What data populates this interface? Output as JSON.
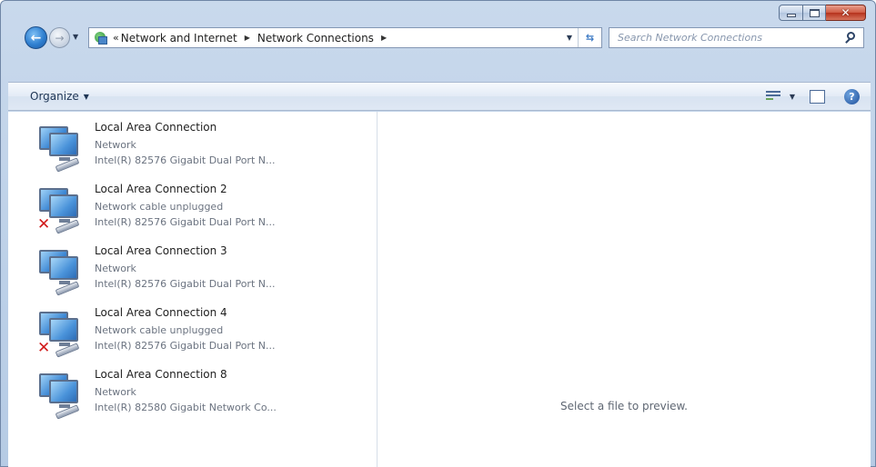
{
  "titlebar": {
    "buttons": {
      "minimize": "minimize",
      "maximize": "maximize",
      "close": "close"
    }
  },
  "address": {
    "overflow": "«",
    "crumbs": [
      "Network and Internet",
      "Network Connections"
    ]
  },
  "search": {
    "placeholder": "Search Network Connections"
  },
  "toolbar": {
    "organize_label": "Organize"
  },
  "connections": [
    {
      "name": "Local Area Connection",
      "status": "Network",
      "device": "Intel(R) 82576 Gigabit Dual Port N...",
      "unplugged": false
    },
    {
      "name": "Local Area Connection 2",
      "status": "Network cable unplugged",
      "device": "Intel(R) 82576 Gigabit Dual Port N...",
      "unplugged": true
    },
    {
      "name": "Local Area Connection 3",
      "status": "Network",
      "device": "Intel(R) 82576 Gigabit Dual Port N...",
      "unplugged": false
    },
    {
      "name": "Local Area Connection 4",
      "status": "Network cable unplugged",
      "device": "Intel(R) 82576 Gigabit Dual Port N...",
      "unplugged": true
    },
    {
      "name": "Local Area Connection 8",
      "status": "Network",
      "device": "Intel(R) 82580 Gigabit Network Co...",
      "unplugged": false
    }
  ],
  "preview": {
    "message": "Select a file to preview."
  },
  "colors": {
    "accent": "#3b86d3",
    "error": "#d11a1a"
  }
}
